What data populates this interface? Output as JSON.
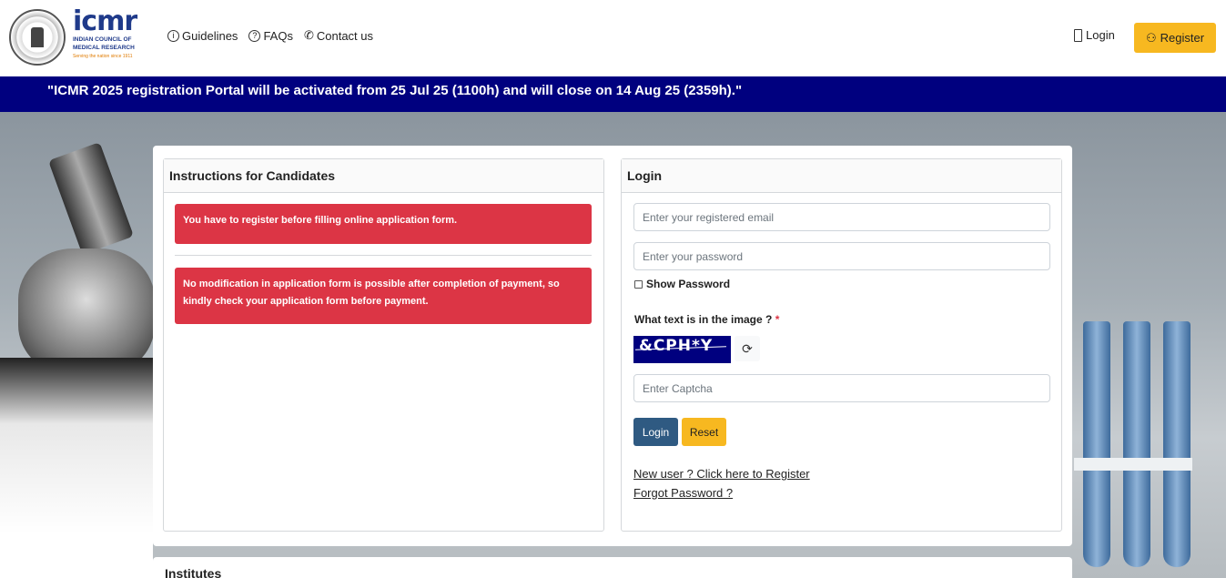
{
  "header": {
    "logo": {
      "brand": "icmr",
      "line1": "INDIAN COUNCIL OF",
      "line2": "MEDICAL RESEARCH",
      "tagline": "Serving the nation since 1911"
    },
    "nav": [
      {
        "label": "Guidelines",
        "icon": "info-icon"
      },
      {
        "label": "FAQs",
        "icon": "question-icon"
      },
      {
        "label": "Contact us",
        "icon": "phone-icon"
      }
    ],
    "login_label": "Login",
    "register_label": "Register"
  },
  "banner": {
    "text": "\"ICMR 2025 registration Portal will be activated from 25 Jul 25 (1100h) and will close on 14 Aug 25 (2359h).\""
  },
  "instructions": {
    "title": "Instructions for Candidates",
    "alerts": [
      "You have to register before filling online application form.",
      "No modification in application form is possible after completion of payment, so kindly check your application form before payment."
    ]
  },
  "login_form": {
    "title": "Login",
    "email_placeholder": "Enter your registered email",
    "password_placeholder": "Enter your password",
    "show_password_label": "Show Password",
    "captcha_label": "What text is in the image ?",
    "required_mark": "*",
    "captcha_text": "&CPH*Y",
    "captcha_placeholder": "Enter Captcha",
    "login_button": "Login",
    "reset_button": "Reset",
    "register_link": "New user ? Click here to Register",
    "forgot_link": "Forgot Password ?"
  },
  "institutes": {
    "title": "Institutes"
  },
  "colors": {
    "banner_bg": "#00007f",
    "accent_yellow": "#f7b820",
    "alert_red": "#dc3545",
    "login_btn": "#2f5a82"
  }
}
